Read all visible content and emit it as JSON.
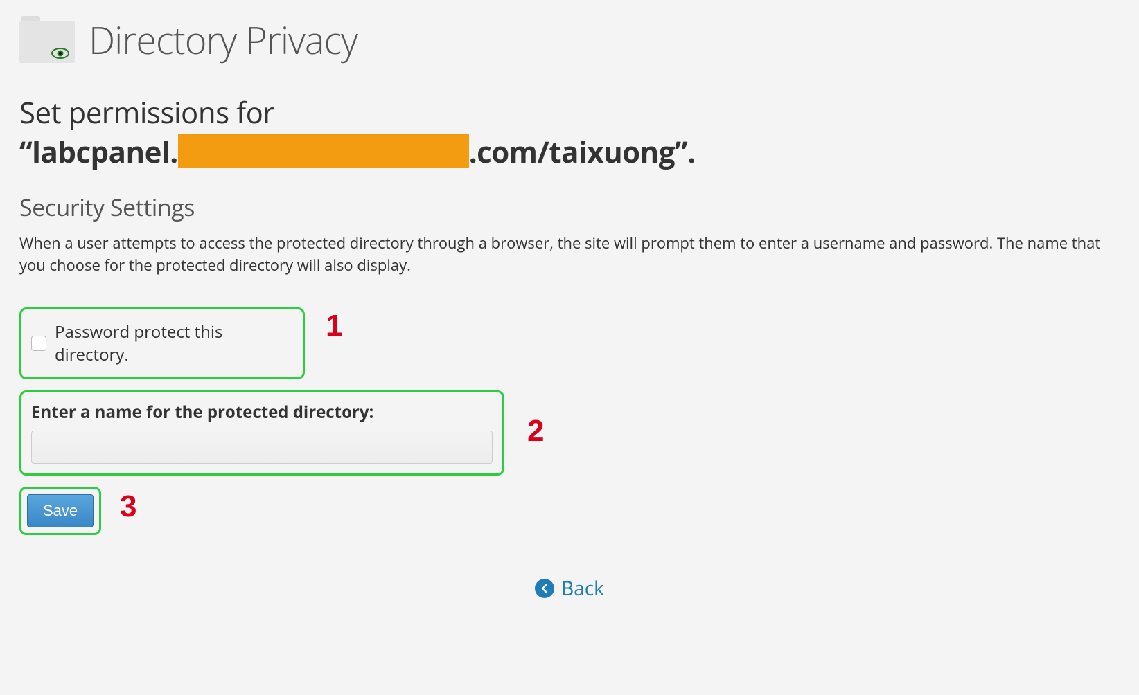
{
  "header": {
    "title": "Directory Privacy"
  },
  "permissions": {
    "prefix": "Set permissions for",
    "path_pre": "“labcpanel.",
    "path_post": ".com/taixuong”."
  },
  "security": {
    "title": "Security Settings",
    "description": "When a user attempts to access the protected directory through a browser, the site will prompt them to enter a username and password. The name that you choose for the protected directory will also display."
  },
  "form": {
    "checkbox_label": "Password protect this directory.",
    "name_label": "Enter a name for the protected directory:",
    "name_value": "",
    "save_label": "Save"
  },
  "annotations": {
    "a1": "1",
    "a2": "2",
    "a3": "3"
  },
  "back": {
    "label": "Back"
  }
}
